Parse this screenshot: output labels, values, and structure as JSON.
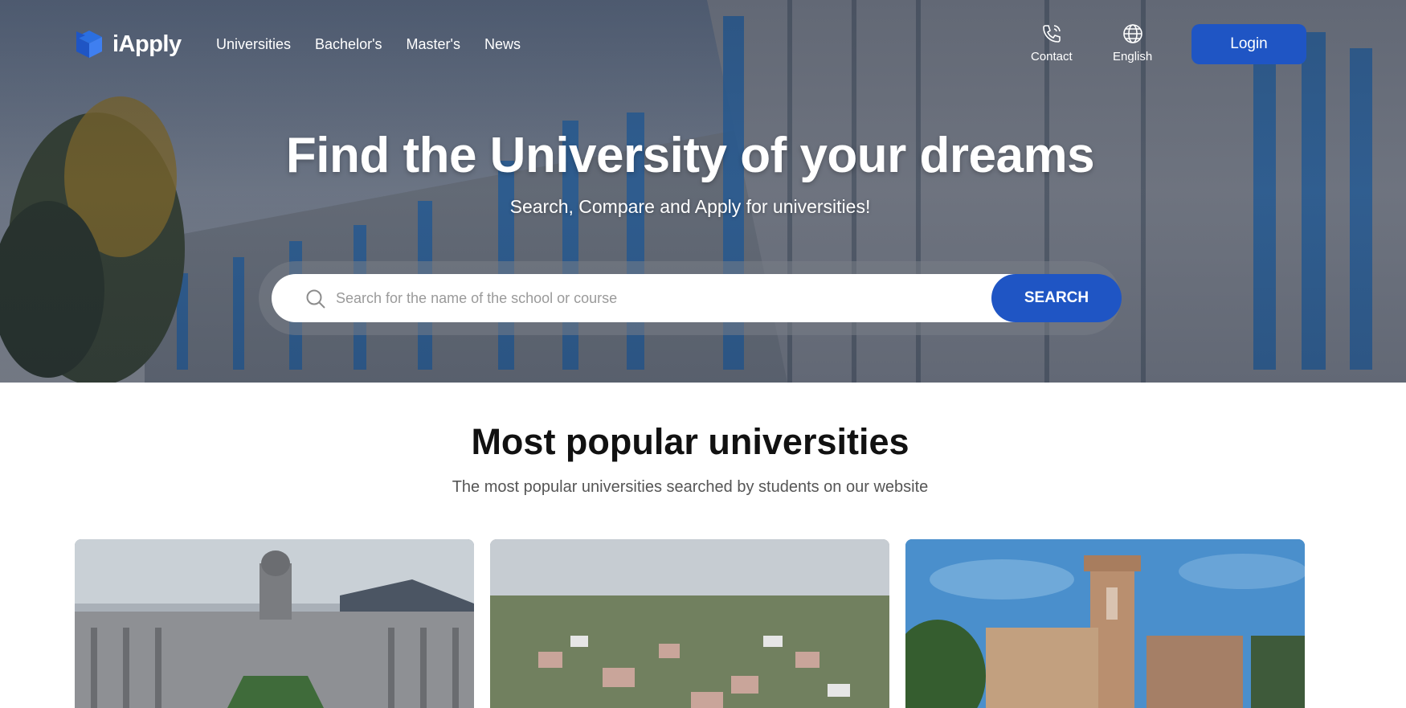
{
  "brand": {
    "name": "iApply",
    "accent": "#1f55c4"
  },
  "nav": {
    "links": [
      "Universities",
      "Bachelor's",
      "Master's",
      "News"
    ],
    "contact_label": "Contact",
    "language_label": "English",
    "login_label": "Login"
  },
  "hero": {
    "title": "Find the University of your dreams",
    "subtitle": "Search, Compare and Apply for universities!",
    "search": {
      "placeholder": "Search for the name of the school or course",
      "button_label": "SEARCH"
    }
  },
  "popular": {
    "title": "Most popular universities",
    "subtitle": "The most popular universities searched by students on our website"
  }
}
